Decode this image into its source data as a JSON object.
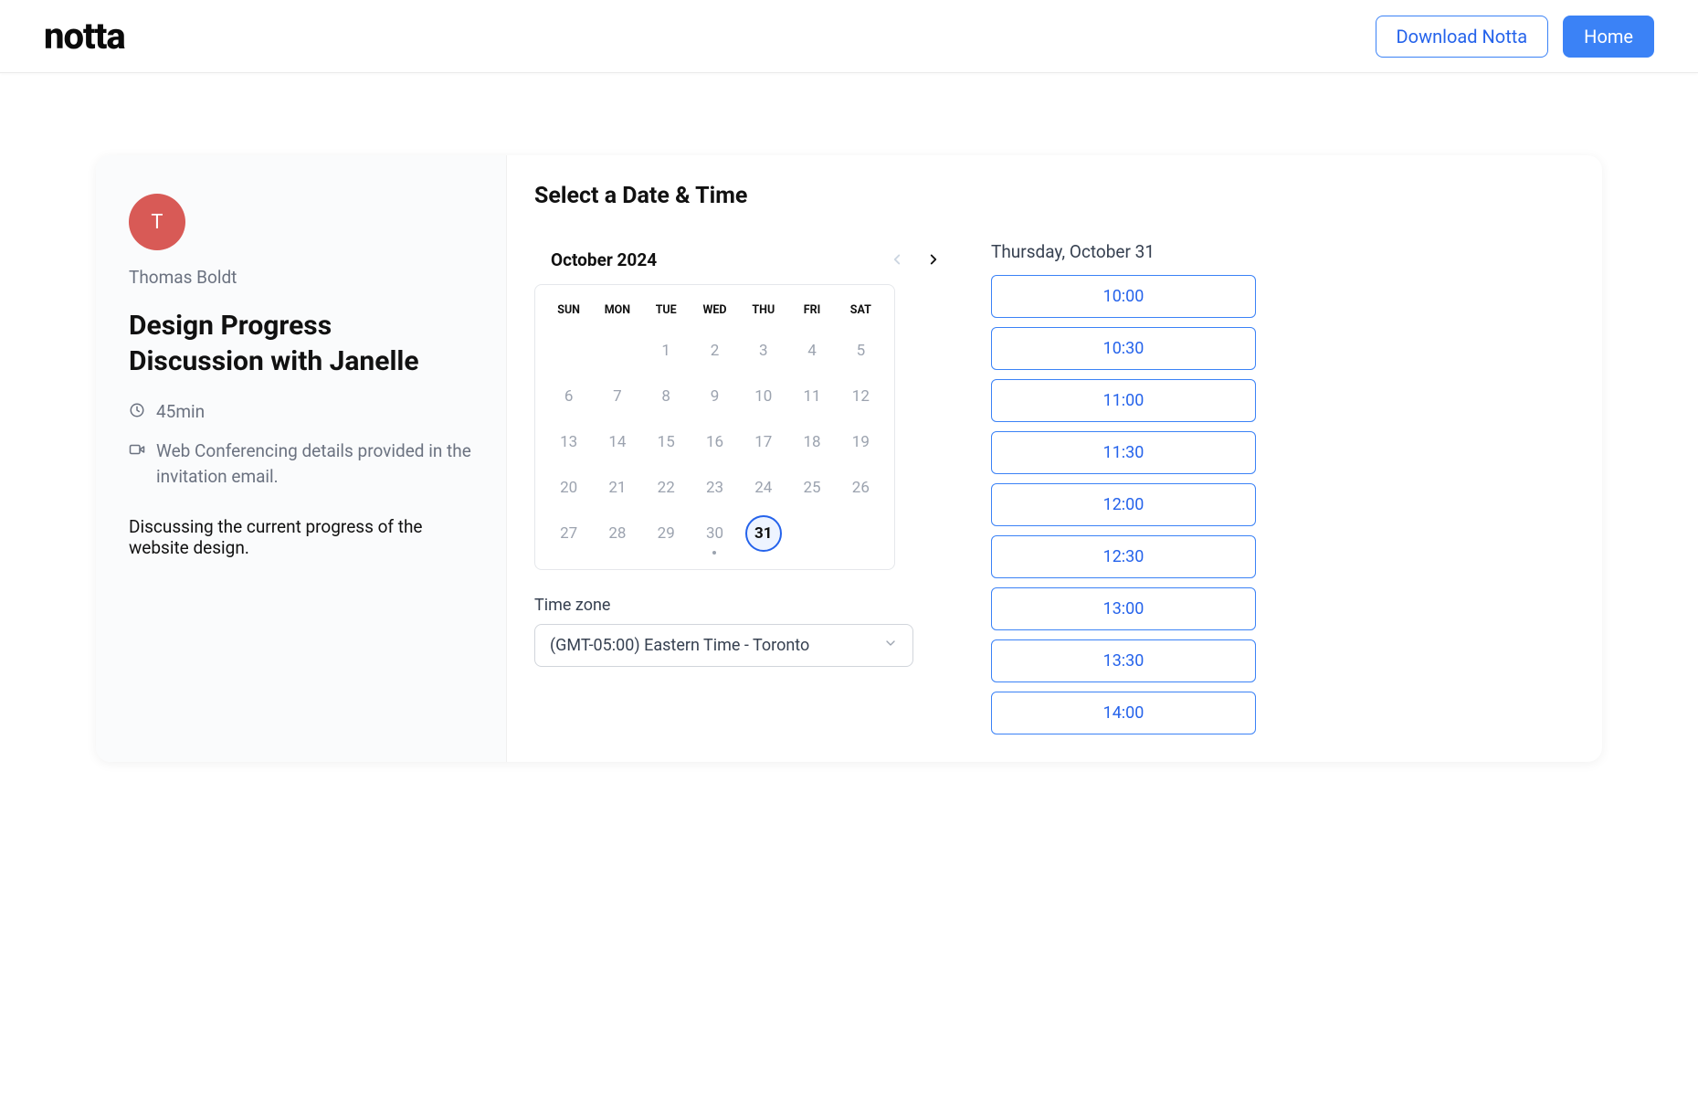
{
  "topbar": {
    "logo": "notta",
    "download_label": "Download Notta",
    "home_label": "Home"
  },
  "side": {
    "avatar_initial": "T",
    "host_name": "Thomas Boldt",
    "meeting_title": "Design Progress Discussion with Janelle",
    "duration": "45min",
    "location": "Web Conferencing details provided in the invitation email.",
    "description": "Discussing the current progress of the website design."
  },
  "main": {
    "panel_title": "Select a Date & Time",
    "month_label": "October 2024",
    "dow": [
      "SUN",
      "MON",
      "TUE",
      "WED",
      "THU",
      "FRI",
      "SAT"
    ],
    "weeks": [
      [
        {
          "n": ""
        },
        {
          "n": ""
        },
        {
          "n": "1"
        },
        {
          "n": "2"
        },
        {
          "n": "3"
        },
        {
          "n": "4"
        },
        {
          "n": "5"
        }
      ],
      [
        {
          "n": "6"
        },
        {
          "n": "7"
        },
        {
          "n": "8"
        },
        {
          "n": "9"
        },
        {
          "n": "10"
        },
        {
          "n": "11"
        },
        {
          "n": "12"
        }
      ],
      [
        {
          "n": "13"
        },
        {
          "n": "14"
        },
        {
          "n": "15"
        },
        {
          "n": "16"
        },
        {
          "n": "17"
        },
        {
          "n": "18"
        },
        {
          "n": "19"
        }
      ],
      [
        {
          "n": "20"
        },
        {
          "n": "21"
        },
        {
          "n": "22"
        },
        {
          "n": "23"
        },
        {
          "n": "24"
        },
        {
          "n": "25"
        },
        {
          "n": "26"
        }
      ],
      [
        {
          "n": "27"
        },
        {
          "n": "28"
        },
        {
          "n": "29"
        },
        {
          "n": "30",
          "dot": true
        },
        {
          "n": "31",
          "selected": true
        },
        {
          "n": ""
        },
        {
          "n": ""
        }
      ]
    ],
    "timezone_label": "Time zone",
    "timezone_value": "(GMT-05:00) Eastern Time - Toronto"
  },
  "slots": {
    "date_label": "Thursday, October 31",
    "times": [
      "10:00",
      "10:30",
      "11:00",
      "11:30",
      "12:00",
      "12:30",
      "13:00",
      "13:30",
      "14:00"
    ]
  }
}
